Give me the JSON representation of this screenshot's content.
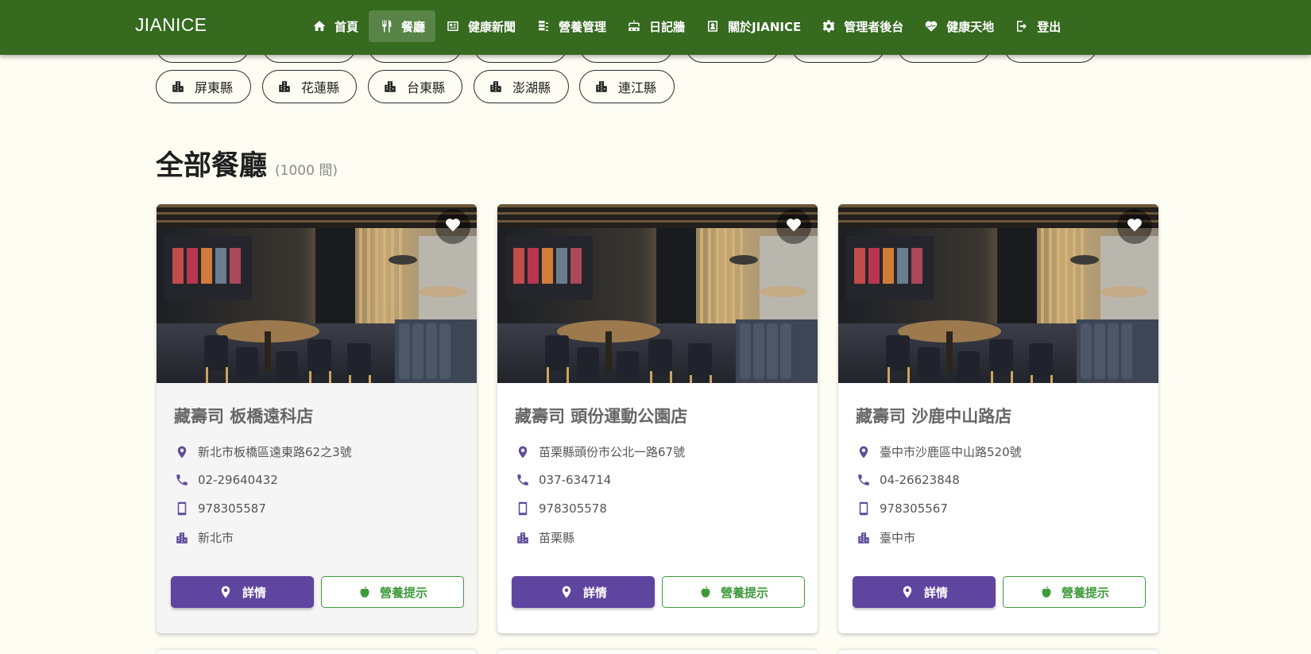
{
  "brand": "JIANICE",
  "nav": [
    {
      "label": "首頁",
      "icon": "home-icon"
    },
    {
      "label": "餐廳",
      "icon": "utensils-icon",
      "active": true
    },
    {
      "label": "健康新聞",
      "icon": "newspaper-icon"
    },
    {
      "label": "營養管理",
      "icon": "list-icon"
    },
    {
      "label": "日記牆",
      "icon": "robot-icon"
    },
    {
      "label": "關於JIANICE",
      "icon": "id-card-icon"
    },
    {
      "label": "管理者後台",
      "icon": "gear-icon"
    },
    {
      "label": "健康天地",
      "icon": "heart-pulse-icon"
    },
    {
      "label": "登出",
      "icon": "logout-icon"
    }
  ],
  "chips": [
    "屏東縣",
    "花蓮縣",
    "台東縣",
    "澎湖縣",
    "連江縣"
  ],
  "section": {
    "title": "全部餐廳",
    "count": "(1000 間)"
  },
  "cards": [
    {
      "name": "藏壽司 板橋遠科店",
      "address": "新北市板橋區遠東路62之3號",
      "phone": "02-29640432",
      "mobile": "978305587",
      "city": "新北市",
      "detail_label": "詳情",
      "nutrition_label": "營養提示"
    },
    {
      "name": "藏壽司 頭份運動公園店",
      "address": "苗栗縣頭份市公北一路67號",
      "phone": "037-634714",
      "mobile": "978305578",
      "city": "苗栗縣",
      "detail_label": "詳情",
      "nutrition_label": "營養提示"
    },
    {
      "name": "藏壽司 沙鹿中山路店",
      "address": "臺中市沙鹿區中山路520號",
      "phone": "04-26623848",
      "mobile": "978305567",
      "city": "臺中市",
      "detail_label": "詳情",
      "nutrition_label": "營養提示"
    }
  ],
  "colors": {
    "navbar": "#356a1f",
    "primary": "#5e45a0",
    "success": "#3f9a3b",
    "background": "#fdfdf3"
  }
}
